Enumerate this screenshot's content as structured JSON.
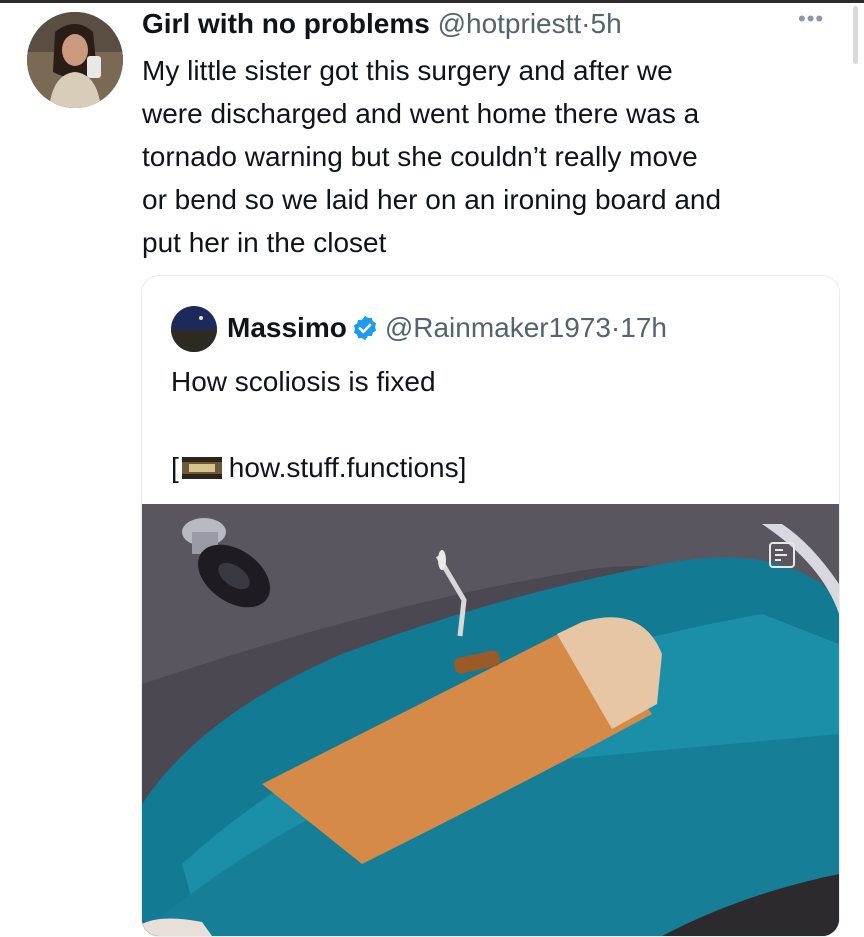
{
  "tweet": {
    "author_name": "Girl with no problems",
    "author_meta": "@hotpriestt·5h",
    "more_icon": "ellipsis-icon",
    "text": "My little sister got this surgery and after we\nwere discharged and went home there was a\ntornado warning but she couldn’t really move\nor bend so we laid her on an ironing board and\nput her in the closet"
  },
  "quote": {
    "author_name": "Massimo",
    "verified_icon": "verified-badge-icon",
    "author_meta": "@Rainmaker1973·17h",
    "text": "How scoliosis is fixed",
    "link_open": "[",
    "link_text": "how.stuff.functions]",
    "media_description_icon": "surgery-animation-video"
  },
  "colors": {
    "text": "#0f1419",
    "secondary": "#536471",
    "verified": "#1d9bf0",
    "border": "#e6ecf0"
  }
}
